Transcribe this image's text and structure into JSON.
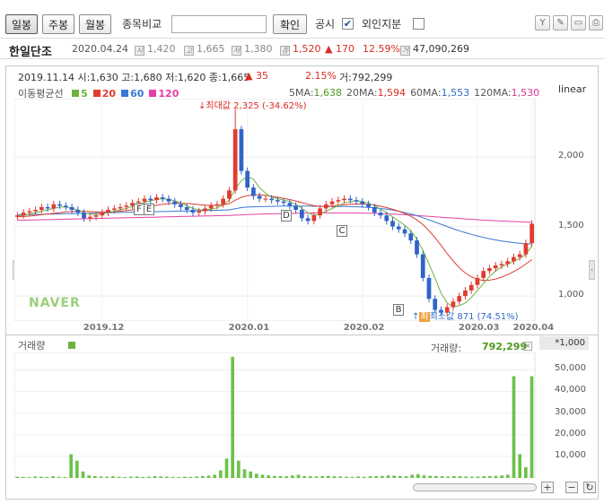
{
  "toolbar": {
    "period_buttons": [
      {
        "label": "일봉",
        "active": true
      },
      {
        "label": "주봉",
        "active": false
      },
      {
        "label": "월봉",
        "active": false
      }
    ],
    "compare_label": "종목비교",
    "compare_input_value": "",
    "confirm_label": "확인",
    "notice_label": "공시",
    "notice_checked": true,
    "foreign_label": "외인지분",
    "foreign_checked": false
  },
  "stock": {
    "name": "한일단조",
    "date": "2020.04.24",
    "open": "1,420",
    "high": "1,665",
    "low": "1,380",
    "close": "1,520",
    "change": "▲ 170",
    "change_pct": "12.59%",
    "volume": "47,090,269",
    "badges": {
      "open": "시",
      "high": "고",
      "low": "저",
      "close": "종",
      "volume": "거"
    }
  },
  "chart_header": {
    "date": "2019.11.14",
    "ohlc_text": "시:1,630 고:1,680 저:1,620 종:1,665",
    "change": "▲ 35",
    "change_pct": "2.15%",
    "volume_text": "거:792,299",
    "ma_title": "이동평균선",
    "ma_legend": [
      {
        "label": "5",
        "color": "#6cb33f"
      },
      {
        "label": "20",
        "color": "#e03c31"
      },
      {
        "label": "60",
        "color": "#3a78d6"
      },
      {
        "label": "120",
        "color": "#e43fa6"
      }
    ],
    "ma_values": [
      {
        "name": "5MA:",
        "value": "1,638",
        "color": "#4a9a1e"
      },
      {
        "name": "20MA:",
        "value": "1,594",
        "color": "#d92b20"
      },
      {
        "name": "60MA:",
        "value": "1,553",
        "color": "#2c6cc8"
      },
      {
        "name": "120MA:",
        "value": "1,530",
        "color": "#d6359a"
      }
    ],
    "scale": "linear",
    "watermark": "NAVER"
  },
  "annotations": {
    "max_label": "최대값 2,325 (-34.62%)",
    "min_label": "최소값 871 (74.51%)",
    "markers": [
      "F",
      "E",
      "D",
      "C",
      "B"
    ]
  },
  "volume_header": {
    "title": "거래량",
    "value_label": "거래량:",
    "value": "792,299",
    "unit": "*1,000"
  },
  "chart_data": [
    {
      "type": "candlestick",
      "x_ticks": [
        "2019.12",
        "2020.01",
        "2020.02",
        "2020.03",
        "2020.04"
      ],
      "y_ticks": [
        2000,
        1500,
        1000
      ],
      "y_tick_labels": [
        "2,000",
        "1,500",
        "1,000"
      ],
      "ylim": [
        820,
        2420
      ],
      "close": [
        1580,
        1600,
        1610,
        1620,
        1640,
        1630,
        1660,
        1650,
        1640,
        1620,
        1600,
        1560,
        1570,
        1580,
        1600,
        1620,
        1630,
        1640,
        1650,
        1670,
        1680,
        1700,
        1690,
        1710,
        1700,
        1680,
        1660,
        1640,
        1620,
        1600,
        1610,
        1630,
        1650,
        1660,
        1700,
        1760,
        2200,
        1900,
        1780,
        1720,
        1700,
        1700,
        1690,
        1680,
        1670,
        1650,
        1620,
        1560,
        1540,
        1580,
        1630,
        1660,
        1680,
        1690,
        1700,
        1690,
        1680,
        1660,
        1640,
        1600,
        1580,
        1540,
        1500,
        1480,
        1450,
        1400,
        1300,
        1130,
        980,
        900,
        880,
        920,
        960,
        1000,
        1040,
        1080,
        1130,
        1180,
        1200,
        1220,
        1230,
        1250,
        1280,
        1300,
        1380,
        1520
      ],
      "ma5": [
        1575,
        1580,
        1590,
        1600,
        1610,
        1620,
        1630,
        1640,
        1640,
        1630,
        1620,
        1600,
        1590,
        1585,
        1590,
        1600,
        1610,
        1620,
        1630,
        1645,
        1660,
        1675,
        1685,
        1695,
        1700,
        1695,
        1685,
        1670,
        1650,
        1630,
        1620,
        1620,
        1625,
        1635,
        1655,
        1690,
        1770,
        1830,
        1860,
        1840,
        1780,
        1740,
        1710,
        1700,
        1690,
        1680,
        1660,
        1630,
        1600,
        1580,
        1590,
        1610,
        1630,
        1650,
        1670,
        1680,
        1685,
        1680,
        1670,
        1650,
        1625,
        1600,
        1570,
        1540,
        1510,
        1470,
        1410,
        1330,
        1230,
        1130,
        1020,
        950,
        920,
        930,
        950,
        990,
        1040,
        1090,
        1140,
        1180,
        1210,
        1230,
        1250,
        1270,
        1300,
        1360
      ],
      "ma20": [
        1570,
        1572,
        1575,
        1580,
        1585,
        1590,
        1595,
        1600,
        1605,
        1608,
        1610,
        1610,
        1608,
        1606,
        1605,
        1606,
        1608,
        1610,
        1614,
        1620,
        1628,
        1636,
        1644,
        1652,
        1660,
        1665,
        1668,
        1668,
        1666,
        1662,
        1658,
        1654,
        1652,
        1652,
        1656,
        1665,
        1690,
        1710,
        1722,
        1728,
        1728,
        1724,
        1718,
        1710,
        1702,
        1694,
        1684,
        1672,
        1660,
        1650,
        1645,
        1645,
        1648,
        1652,
        1656,
        1660,
        1662,
        1662,
        1660,
        1654,
        1646,
        1636,
        1624,
        1610,
        1594,
        1574,
        1548,
        1514,
        1470,
        1420,
        1364,
        1306,
        1252,
        1204,
        1166,
        1138,
        1120,
        1112,
        1114,
        1122,
        1136,
        1154,
        1176,
        1200,
        1230,
        1262
      ],
      "ma60": [
        1585,
        1585,
        1586,
        1587,
        1588,
        1589,
        1590,
        1591,
        1592,
        1593,
        1594,
        1595,
        1596,
        1597,
        1598,
        1599,
        1600,
        1601,
        1602,
        1603,
        1604,
        1605,
        1606,
        1607,
        1608,
        1609,
        1610,
        1611,
        1612,
        1613,
        1614,
        1615,
        1616,
        1617,
        1618,
        1620,
        1628,
        1636,
        1640,
        1642,
        1643,
        1644,
        1645,
        1646,
        1647,
        1648,
        1648,
        1648,
        1647,
        1646,
        1645,
        1644,
        1644,
        1644,
        1644,
        1643,
        1642,
        1640,
        1638,
        1635,
        1630,
        1625,
        1618,
        1610,
        1600,
        1590,
        1578,
        1564,
        1548,
        1532,
        1516,
        1500,
        1484,
        1470,
        1456,
        1444,
        1432,
        1422,
        1412,
        1404,
        1396,
        1390,
        1384,
        1380,
        1376,
        1374
      ],
      "ma120": [
        1545,
        1546,
        1547,
        1548,
        1549,
        1550,
        1551,
        1552,
        1553,
        1554,
        1555,
        1556,
        1557,
        1558,
        1559,
        1560,
        1561,
        1562,
        1563,
        1564,
        1565,
        1566,
        1567,
        1568,
        1569,
        1570,
        1571,
        1572,
        1573,
        1574,
        1575,
        1576,
        1577,
        1578,
        1579,
        1580,
        1582,
        1584,
        1586,
        1588,
        1589,
        1590,
        1591,
        1592,
        1593,
        1594,
        1595,
        1596,
        1597,
        1598,
        1598,
        1598,
        1598,
        1598,
        1598,
        1598,
        1598,
        1597,
        1596,
        1595,
        1593,
        1591,
        1589,
        1587,
        1585,
        1582,
        1579,
        1576,
        1573,
        1570,
        1567,
        1564,
        1561,
        1558,
        1555,
        1552,
        1549,
        1546,
        1544,
        1542,
        1540,
        1538,
        1536,
        1534,
        1532,
        1530
      ]
    },
    {
      "type": "bar",
      "name": "거래량",
      "y_tick_labels": [
        "50,000",
        "40,000",
        "30,000",
        "20,000",
        "10,000"
      ],
      "ylim": [
        0,
        58000
      ],
      "values": [
        600,
        500,
        400,
        700,
        600,
        500,
        800,
        500,
        400,
        11000,
        8000,
        3000,
        1200,
        900,
        700,
        600,
        800,
        500,
        400,
        600,
        700,
        500,
        600,
        900,
        700,
        600,
        500,
        400,
        600,
        500,
        700,
        900,
        1100,
        1500,
        3500,
        9000,
        56000,
        8000,
        4000,
        3000,
        2000,
        1500,
        1200,
        1000,
        900,
        800,
        1200,
        1500,
        900,
        800,
        700,
        900,
        1000,
        800,
        700,
        600,
        500,
        700,
        600,
        800,
        900,
        1000,
        1200,
        1100,
        900,
        800,
        1500,
        1800,
        1200,
        1000,
        900,
        800,
        700,
        900,
        800,
        700,
        600,
        700,
        800,
        900,
        1000,
        1200,
        1500,
        47000,
        11000,
        5000,
        47000
      ]
    }
  ],
  "icons": {
    "tools": [
      "magnet-icon",
      "pen-icon",
      "cursor-icon",
      "print-icon"
    ]
  }
}
